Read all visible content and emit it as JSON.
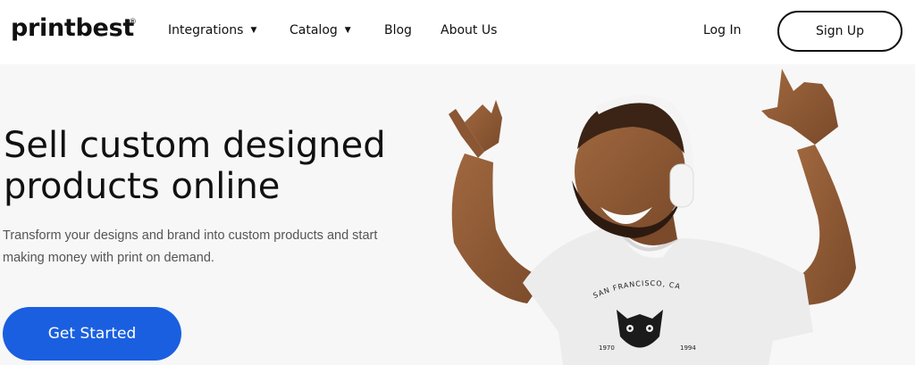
{
  "header": {
    "logo_text": "printbest",
    "logo_mark": "®",
    "nav": [
      {
        "label": "Integrations",
        "has_dropdown": true
      },
      {
        "label": "Catalog",
        "has_dropdown": true
      },
      {
        "label": "Blog",
        "has_dropdown": false
      },
      {
        "label": "About Us",
        "has_dropdown": false
      }
    ],
    "login_label": "Log In",
    "signup_label": "Sign Up"
  },
  "hero": {
    "title": "Sell custom designed products online",
    "subtitle": "Transform your designs and brand into custom products and start making money with print on demand.",
    "cta_label": "Get Started",
    "shirt_print": {
      "arc_text": "SAN FRANCISCO, CA",
      "left_year": "1970",
      "right_year": "1994"
    }
  },
  "colors": {
    "accent": "#1a5fe0",
    "background": "#f7f7f7",
    "text": "#111111"
  },
  "icons": {
    "dropdown": "chevron-down-icon"
  }
}
